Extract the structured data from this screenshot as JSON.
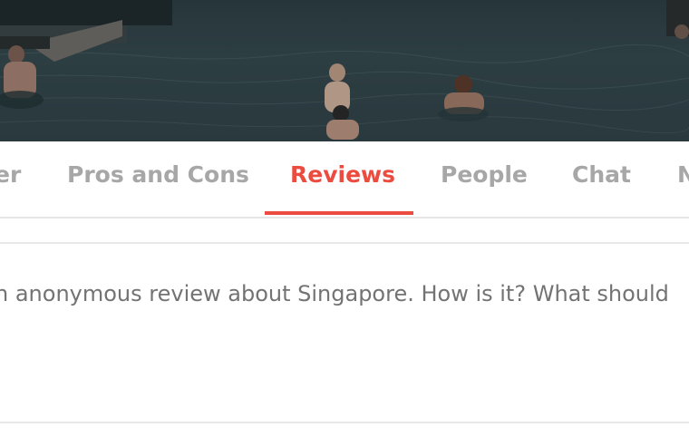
{
  "tabs": [
    {
      "label": "er",
      "active": false
    },
    {
      "label": "Pros and Cons",
      "active": false
    },
    {
      "label": "Reviews",
      "active": true
    },
    {
      "label": "People",
      "active": false
    },
    {
      "label": "Chat",
      "active": false
    },
    {
      "label": "N",
      "active": false
    }
  ],
  "review": {
    "placeholder": "n anonymous review about Singapore. How is it? What should"
  },
  "colors": {
    "accent": "#ec4b3f",
    "tab_inactive": "#a7a7a7",
    "placeholder_text": "#737373",
    "divider": "#e8e8e8"
  }
}
